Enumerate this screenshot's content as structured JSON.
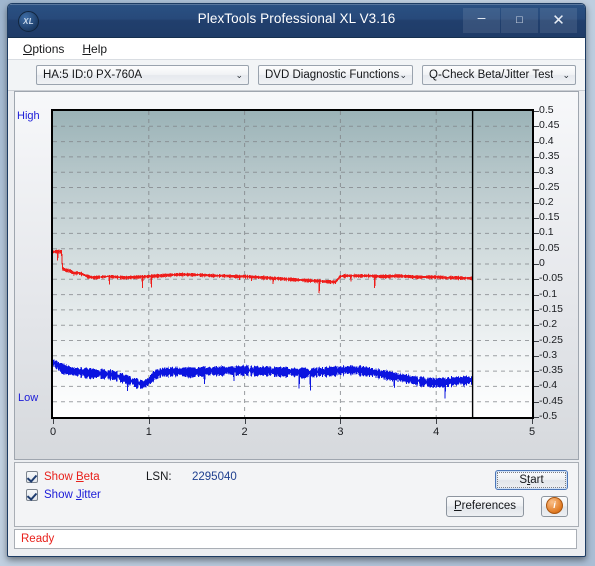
{
  "window": {
    "title": "PlexTools Professional XL V3.16",
    "logo_text": "XL",
    "minimize_glyph": "–",
    "maximize_glyph": "□",
    "close_glyph": "✕"
  },
  "menubar": {
    "items": [
      {
        "label": "Options",
        "accel": "O"
      },
      {
        "label": "Help",
        "accel": "H"
      }
    ]
  },
  "toolbar": {
    "drive": "HA:5 ID:0  PX-760A",
    "function": "DVD Diagnostic Functions",
    "test": "Q-Check Beta/Jitter Test",
    "arrow": "⌄"
  },
  "controls": {
    "show_beta": "Show Beta",
    "show_jitter": "Show Jitter",
    "lsn_label": "LSN:",
    "lsn_value": "2295040",
    "start": "Start",
    "preferences": "Preferences",
    "info_glyph": "i"
  },
  "status": {
    "text": "Ready"
  },
  "colors": {
    "beta": "#ee1d1a",
    "jitter": "#0b14e0",
    "axis": "#000000",
    "grid": "#808488",
    "titlebar": "#21406e",
    "status_text": "#e8211c"
  },
  "chart_data": {
    "type": "line",
    "title": "",
    "xlabel": "",
    "ylabel": "",
    "xlim": [
      0,
      5
    ],
    "ylim": [
      -0.5,
      0.5
    ],
    "grid": true,
    "legend_position": "bottom-left",
    "left_axis_labels": {
      "top": "High",
      "bottom": "Low"
    },
    "xticks": [
      0,
      1,
      2,
      3,
      4,
      5
    ],
    "yticks": [
      0.5,
      0.45,
      0.4,
      0.35,
      0.3,
      0.25,
      0.2,
      0.15,
      0.1,
      0.05,
      0,
      -0.05,
      -0.1,
      -0.15,
      -0.2,
      -0.25,
      -0.3,
      -0.35,
      -0.4,
      -0.45,
      -0.5
    ],
    "data_end_x": 4.38,
    "series": [
      {
        "name": "Beta",
        "color": "#ee1d1a",
        "x": [
          0.0,
          0.05,
          0.09,
          0.1,
          0.14,
          0.18,
          0.22,
          0.26,
          0.3,
          0.36,
          0.42,
          0.5,
          0.58,
          0.66,
          0.74,
          0.82,
          0.9,
          1.0,
          1.1,
          1.2,
          1.3,
          1.4,
          1.5,
          1.6,
          1.7,
          1.8,
          1.9,
          2.0,
          2.1,
          2.2,
          2.3,
          2.4,
          2.5,
          2.6,
          2.7,
          2.8,
          2.9,
          2.95,
          3.0,
          3.05,
          3.1,
          3.2,
          3.3,
          3.4,
          3.5,
          3.6,
          3.7,
          3.8,
          3.9,
          4.0,
          4.1,
          4.2,
          4.3,
          4.38
        ],
        "y": [
          0.04,
          0.042,
          0.041,
          -0.015,
          -0.02,
          -0.022,
          -0.03,
          -0.028,
          -0.032,
          -0.04,
          -0.044,
          -0.042,
          -0.04,
          -0.042,
          -0.044,
          -0.043,
          -0.042,
          -0.04,
          -0.038,
          -0.036,
          -0.034,
          -0.034,
          -0.035,
          -0.036,
          -0.038,
          -0.038,
          -0.04,
          -0.04,
          -0.042,
          -0.044,
          -0.046,
          -0.048,
          -0.05,
          -0.052,
          -0.054,
          -0.056,
          -0.058,
          -0.058,
          -0.04,
          -0.038,
          -0.038,
          -0.038,
          -0.038,
          -0.04,
          -0.04,
          -0.038,
          -0.04,
          -0.042,
          -0.042,
          -0.042,
          -0.044,
          -0.044,
          -0.046,
          -0.046
        ],
        "noise_amp": 0.006,
        "spike_amp": 0.035
      },
      {
        "name": "Jitter",
        "color": "#0b14e0",
        "x": [
          0.0,
          0.05,
          0.1,
          0.16,
          0.22,
          0.3,
          0.38,
          0.46,
          0.54,
          0.62,
          0.7,
          0.78,
          0.86,
          0.94,
          1.0,
          1.06,
          1.14,
          1.24,
          1.34,
          1.44,
          1.54,
          1.64,
          1.74,
          1.84,
          1.94,
          2.04,
          2.14,
          2.24,
          2.34,
          2.44,
          2.54,
          2.64,
          2.74,
          2.84,
          2.94,
          3.0,
          3.1,
          3.2,
          3.3,
          3.4,
          3.5,
          3.6,
          3.7,
          3.8,
          3.9,
          4.0,
          4.1,
          4.2,
          4.3,
          4.38
        ],
        "y": [
          -0.32,
          -0.33,
          -0.34,
          -0.345,
          -0.35,
          -0.352,
          -0.355,
          -0.356,
          -0.358,
          -0.36,
          -0.368,
          -0.376,
          -0.386,
          -0.392,
          -0.382,
          -0.36,
          -0.352,
          -0.35,
          -0.35,
          -0.352,
          -0.35,
          -0.348,
          -0.348,
          -0.346,
          -0.346,
          -0.346,
          -0.348,
          -0.348,
          -0.35,
          -0.35,
          -0.352,
          -0.354,
          -0.352,
          -0.35,
          -0.348,
          -0.346,
          -0.344,
          -0.346,
          -0.35,
          -0.356,
          -0.362,
          -0.368,
          -0.374,
          -0.38,
          -0.384,
          -0.386,
          -0.384,
          -0.38,
          -0.378,
          -0.378
        ],
        "noise_amp": 0.02,
        "spike_amp": 0.055
      }
    ]
  }
}
